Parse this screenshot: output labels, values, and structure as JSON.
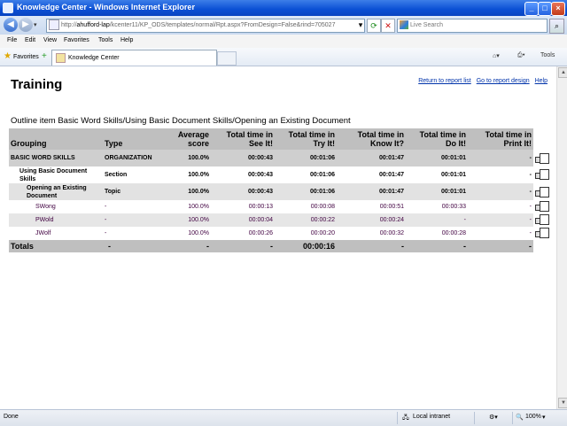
{
  "window": {
    "title": "Knowledge Center - Windows Internet Explorer",
    "url_prefix": "http://",
    "url_host": "ahufford-lap",
    "url_rest": "/kcenter11/KP_ODS/templates/normal/Rpt.aspx?FromDesign=False&rind=705027",
    "search_placeholder": "Live Search"
  },
  "menu": [
    "File",
    "Edit",
    "View",
    "Favorites",
    "Tools",
    "Help"
  ],
  "favbar": {
    "favorites_label": "Favorites",
    "tab_label": "Knowledge Center",
    "tools_label": "Tools"
  },
  "page": {
    "title": "Training",
    "link_return": "Return to report list",
    "link_design": "Go to report design",
    "link_help": "Help",
    "outline": "Outline item Basic Word Skills/Using Basic Document Skills/Opening an Existing Document"
  },
  "table": {
    "headers": [
      "Grouping",
      "Type",
      "Average score",
      "Total time in See It!",
      "Total time in Try It!",
      "Total time in Know It?",
      "Total time in Do It!",
      "Total time in Print It!"
    ],
    "rows": [
      [
        "BASIC WORD SKILLS",
        "ORGANIZATION",
        "100.0%",
        "00:00:43",
        "00:01:06",
        "00:01:47",
        "00:01:01",
        "-"
      ],
      [
        "Using Basic Document Skills",
        "Section",
        "100.0%",
        "00:00:43",
        "00:01:06",
        "00:01:47",
        "00:01:01",
        "-"
      ],
      [
        "Opening an Existing Document",
        "Topic",
        "100.0%",
        "00:00:43",
        "00:01:06",
        "00:01:47",
        "00:01:01",
        "-"
      ],
      [
        "SWong",
        "-",
        "100.0%",
        "00:00:13",
        "00:00:08",
        "00:00:51",
        "00:00:33",
        "-"
      ],
      [
        "PWold",
        "-",
        "100.0%",
        "00:00:04",
        "00:00:22",
        "00:00:24",
        "-",
        "-"
      ],
      [
        "JWolf",
        "-",
        "100.0%",
        "00:00:26",
        "00:00:20",
        "00:00:32",
        "00:00:28",
        "-"
      ]
    ],
    "totals": [
      "Totals",
      "-",
      "-",
      "-",
      "00:00:16",
      "-",
      "-",
      "-"
    ]
  },
  "status": {
    "left": "Done",
    "zone": "Local intranet",
    "zoom": "100%"
  }
}
